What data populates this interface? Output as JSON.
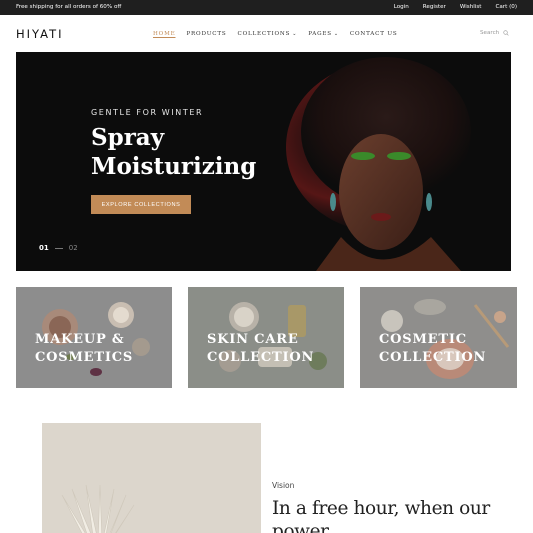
{
  "topbar": {
    "promo": "Free shipping for all orders of 60% off",
    "links": [
      "Login",
      "Register",
      "Wishlist",
      "Cart (0)"
    ]
  },
  "header": {
    "logo": "HIYATI",
    "nav": [
      {
        "label": "HOME",
        "active": true,
        "dropdown": false
      },
      {
        "label": "PRODUCTS",
        "active": false,
        "dropdown": false
      },
      {
        "label": "COLLECTIONS",
        "active": false,
        "dropdown": true
      },
      {
        "label": "PAGES",
        "active": false,
        "dropdown": true
      },
      {
        "label": "CONTACT US",
        "active": false,
        "dropdown": false
      }
    ],
    "search_label": "Search",
    "search_icon": "search-icon"
  },
  "hero": {
    "eyebrow": "GENTLE FOR WINTER",
    "title": "Spray Moisturizing",
    "cta": "EXPLORE COLLECTIONS",
    "slide_current": "01",
    "slide_next": "02"
  },
  "collections": [
    {
      "label": "MAKEUP &\nCOSMETICS"
    },
    {
      "label": "SKIN CARE\nCOLLECTION"
    },
    {
      "label": "COSMETIC\nCOLLECTION"
    }
  ],
  "about": {
    "eyebrow": "Vision",
    "headline": "In a free hour, when our power"
  },
  "colors": {
    "accent": "#c28b57",
    "topbar_bg": "#1f1f1f",
    "hero_bg": "#0c0c0c"
  }
}
